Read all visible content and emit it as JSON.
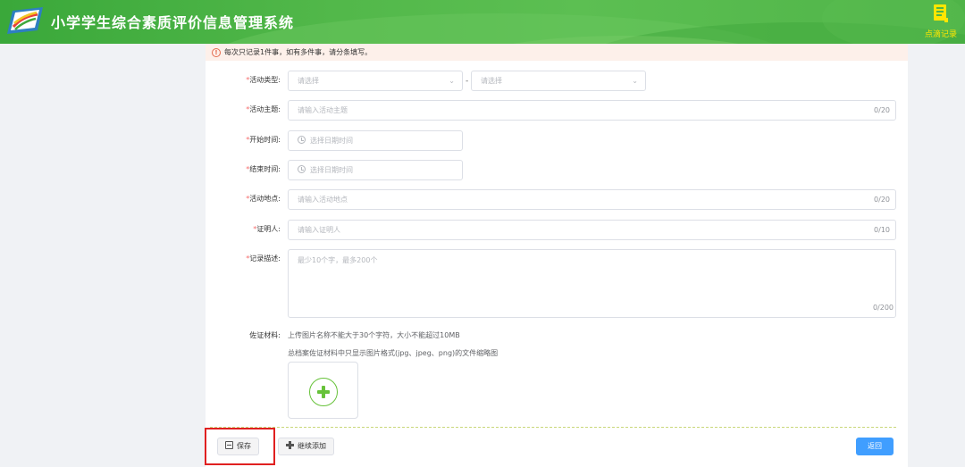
{
  "header": {
    "title": "小学学生综合素质评价信息管理系统",
    "record_label": "点滴记录"
  },
  "notice": "每次只记录1件事，如有多件事，请分条填写。",
  "form": {
    "activity_type": {
      "label": "活动类型:",
      "placeholder1": "请选择",
      "placeholder2": "请选择"
    },
    "activity_theme": {
      "label": "活动主题:",
      "placeholder": "请输入活动主题",
      "count": "0/20"
    },
    "start_time": {
      "label": "开始时间:",
      "placeholder": "选择日期时间"
    },
    "end_time": {
      "label": "结束时间:",
      "placeholder": "选择日期时间"
    },
    "activity_place": {
      "label": "活动地点:",
      "placeholder": "请输入活动地点",
      "count": "0/20"
    },
    "witness": {
      "label": "证明人:",
      "placeholder": "请输入证明人",
      "count": "0/10"
    },
    "description": {
      "label": "记录描述:",
      "placeholder": "最少10个字，最多200个",
      "count": "0/200"
    },
    "evidence": {
      "label": "佐证材料:",
      "hint1": "上传图片名称不能大于30个字符，大小不能超过10MB",
      "hint2": "总档案佐证材料中只显示图片格式(jpg、jpeg、png)的文件缩略图"
    }
  },
  "buttons": {
    "save": "保存",
    "continue_add": "继续添加",
    "back": "返回"
  },
  "colors": {
    "header_green": "#4fb448",
    "required_red": "#f56c6c",
    "primary_blue": "#409eff",
    "upload_green": "#67c23a",
    "highlight_red": "#e02020"
  }
}
